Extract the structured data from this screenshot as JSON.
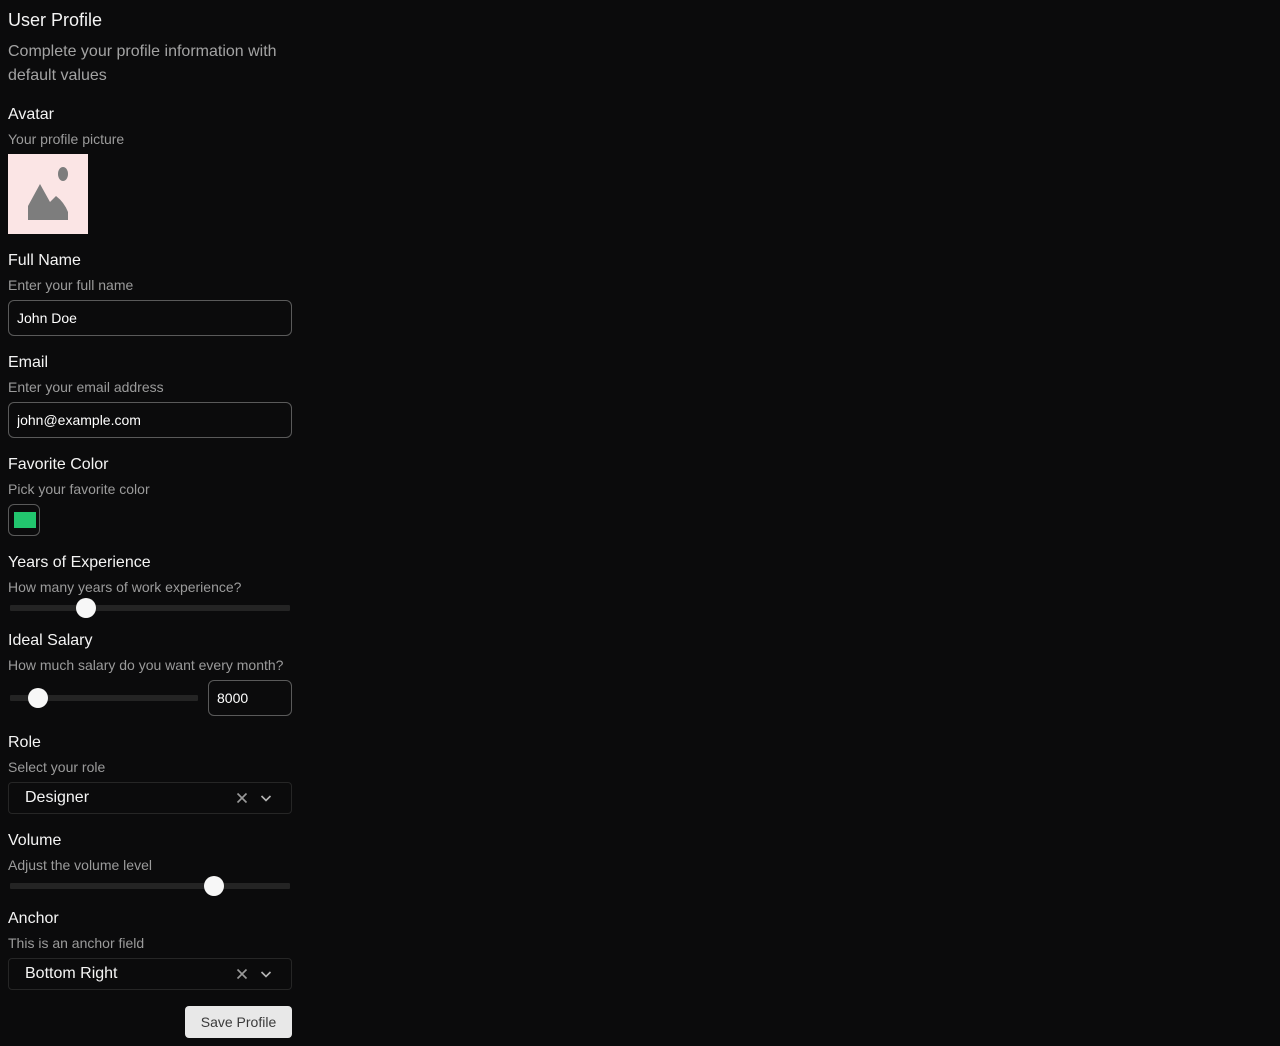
{
  "form": {
    "title": "User Profile",
    "subtitle": "Complete your profile information with default values"
  },
  "avatar": {
    "label": "Avatar",
    "description": "Your profile picture",
    "icon": "image-placeholder-icon",
    "background": "#fbe5e5"
  },
  "full_name": {
    "label": "Full Name",
    "description": "Enter your full name",
    "value": "John Doe"
  },
  "email": {
    "label": "Email",
    "description": "Enter your email address",
    "value": "john@example.com"
  },
  "favorite_color": {
    "label": "Favorite Color",
    "description": "Pick your favorite color",
    "value": "#22c56e"
  },
  "experience": {
    "label": "Years of Experience",
    "description": "How many years of work experience?",
    "level": 0.27
  },
  "salary": {
    "label": "Ideal Salary",
    "description": "How much salary do you want every month?",
    "value": "8000",
    "level": 0.15
  },
  "role": {
    "label": "Role",
    "description": "Select your role",
    "value": "Designer"
  },
  "volume": {
    "label": "Volume",
    "description": "Adjust the volume level",
    "level": 0.73
  },
  "anchor": {
    "label": "Anchor",
    "description": "This is an anchor field",
    "value": "Bottom Right"
  },
  "actions": {
    "save_label": "Save Profile"
  }
}
